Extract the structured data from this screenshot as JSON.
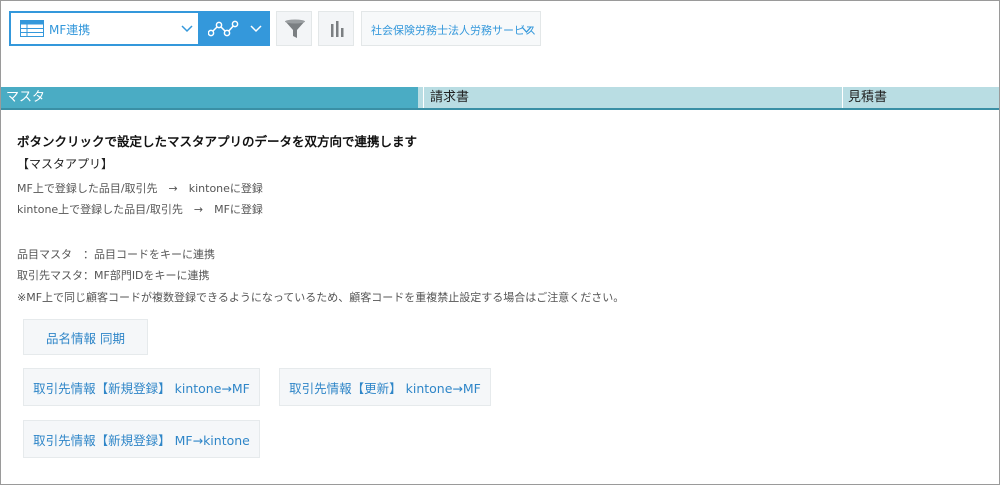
{
  "toolbar": {
    "view_select_label": "MF連携",
    "space_select_label": "社会保険労務士法人労務サービス"
  },
  "tabs": [
    {
      "label": "マスタ"
    },
    {
      "label": "請求書"
    },
    {
      "label": "見積書"
    }
  ],
  "content": {
    "heading": "ボタンクリックで設定したマスタアプリのデータを双方向で連携します",
    "section_label": "【マスタアプリ】",
    "lines": [
      "MF上で登録した品目/取引先　→　kintoneに登録",
      "kintone上で登録した品目/取引先　→　MFに登録",
      "品目マスタ　：品目コードをキーに連携",
      "取引先マスタ：MF部門IDをキーに連携",
      "※MF上で同じ顧客コードが複数登録できるようになっているため、顧客コードを重複禁止設定する場合はご注意ください。"
    ]
  },
  "buttons": {
    "item_sync": "品名情報 同期",
    "client_new_kintone_to_mf": "取引先情報【新規登録】 kintone→MF",
    "client_update_kintone_to_mf": "取引先情報【更新】 kintone→MF",
    "client_new_mf_to_kintone": "取引先情報【新規登録】 MF→kintone"
  },
  "colors": {
    "accent": "#3498db",
    "tab_active": "#4aacc4",
    "tab_bar": "#b9dde3",
    "button_text": "#2f86c8"
  }
}
